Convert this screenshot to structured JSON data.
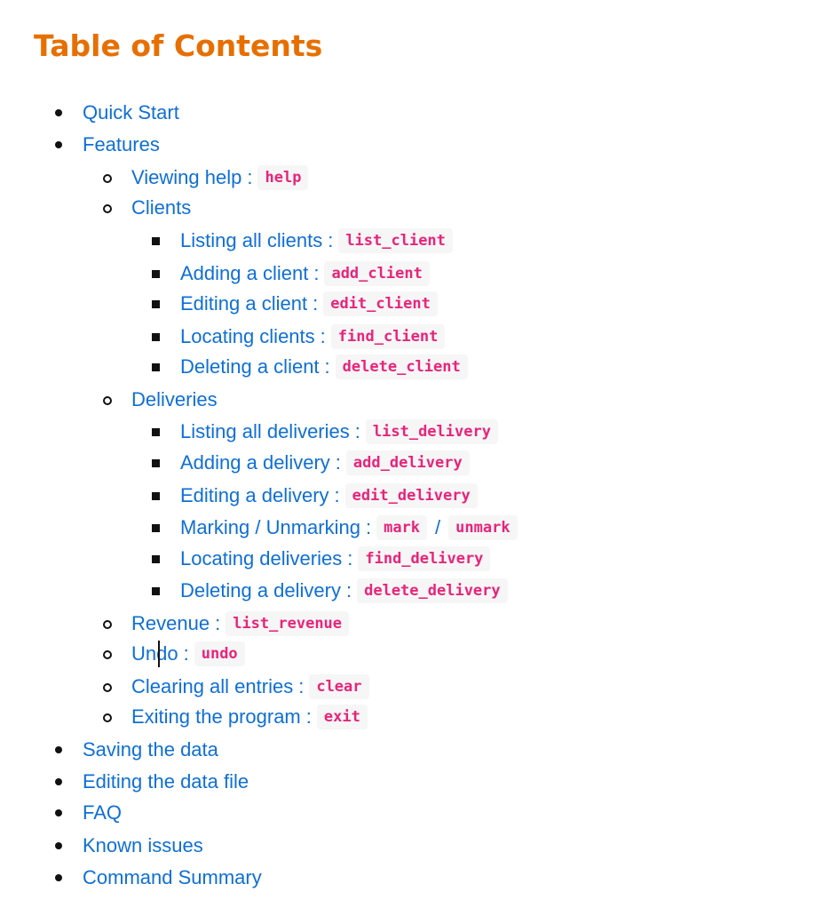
{
  "title": "Table of Contents",
  "toc": {
    "quick_start": "Quick Start",
    "features": "Features",
    "viewing_help": {
      "label": "Viewing help",
      "sep": ":",
      "cmd": "help"
    },
    "clients": "Clients",
    "listing_clients": {
      "label": "Listing all clients",
      "sep": ":",
      "cmd": "list_client"
    },
    "adding_client": {
      "label": "Adding a client",
      "sep": ":",
      "cmd": "add_client"
    },
    "editing_client": {
      "label": "Editing a client",
      "sep": ":",
      "cmd": "edit_client"
    },
    "locating_clients": {
      "label": "Locating clients",
      "sep": ":",
      "cmd": "find_client"
    },
    "deleting_client": {
      "label": "Deleting a client",
      "sep": ":",
      "cmd": "delete_client"
    },
    "deliveries": "Deliveries",
    "listing_deliveries": {
      "label": "Listing all deliveries",
      "sep": ":",
      "cmd": "list_delivery"
    },
    "adding_delivery": {
      "label": "Adding a delivery",
      "sep": ":",
      "cmd": "add_delivery"
    },
    "editing_delivery": {
      "label": "Editing a delivery",
      "sep": ":",
      "cmd": "edit_delivery"
    },
    "marking": {
      "label": "Marking / Unmarking",
      "sep": ":",
      "cmd": "mark",
      "slash": "/",
      "cmd2": "unmark"
    },
    "locating_deliveries": {
      "label": "Locating deliveries",
      "sep": ":",
      "cmd": "find_delivery"
    },
    "deleting_delivery": {
      "label": "Deleting a delivery",
      "sep": ":",
      "cmd": "delete_delivery"
    },
    "revenue": {
      "label": "Revenue",
      "sep": ":",
      "cmd": "list_revenue"
    },
    "undo": {
      "label": "Undo",
      "sep": ":",
      "cmd": "undo"
    },
    "clearing": {
      "label": "Clearing all entries",
      "sep": ":",
      "cmd": "clear"
    },
    "exiting": {
      "label": "Exiting the program",
      "sep": ":",
      "cmd": "exit"
    },
    "saving": "Saving the data",
    "editing_file": "Editing the data file",
    "faq": "FAQ",
    "known_issues": "Known issues",
    "command_summary": "Command Summary"
  },
  "colors": {
    "title": "#e76f00",
    "link": "#0e6fd6",
    "code_text": "#e8247a",
    "code_bg": "#f6f6f6"
  }
}
